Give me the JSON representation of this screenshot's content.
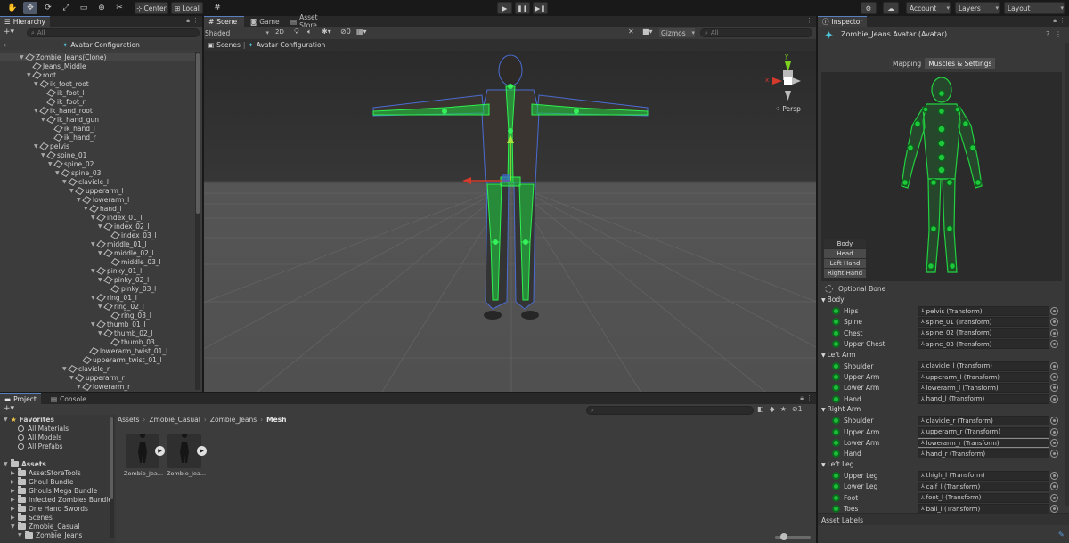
{
  "toolbar": {
    "center_label": "Center",
    "local_label": "Local",
    "account_label": "Account",
    "layers_label": "Layers",
    "layout_label": "Layout"
  },
  "hierarchy": {
    "tab": "Hierarchy",
    "search_placeholder": "All",
    "header": "Avatar Configuration",
    "items": [
      {
        "label": "Zombie_Jeans(Clone)"
      },
      {
        "label": "Jeans_Middle"
      },
      {
        "label": "root"
      },
      {
        "label": "ik_foot_root"
      },
      {
        "label": "ik_foot_l"
      },
      {
        "label": "ik_foot_r"
      },
      {
        "label": "ik_hand_root"
      },
      {
        "label": "ik_hand_gun"
      },
      {
        "label": "ik_hand_l"
      },
      {
        "label": "ik_hand_r"
      },
      {
        "label": "pelvis"
      },
      {
        "label": "spine_01"
      },
      {
        "label": "spine_02"
      },
      {
        "label": "spine_03"
      },
      {
        "label": "clavicle_l"
      },
      {
        "label": "upperarm_l"
      },
      {
        "label": "lowerarm_l"
      },
      {
        "label": "hand_l"
      },
      {
        "label": "index_01_l"
      },
      {
        "label": "index_02_l"
      },
      {
        "label": "index_03_l"
      },
      {
        "label": "middle_01_l"
      },
      {
        "label": "middle_02_l"
      },
      {
        "label": "middle_03_l"
      },
      {
        "label": "pinky_01_l"
      },
      {
        "label": "pinky_02_l"
      },
      {
        "label": "pinky_03_l"
      },
      {
        "label": "ring_01_l"
      },
      {
        "label": "ring_02_l"
      },
      {
        "label": "ring_03_l"
      },
      {
        "label": "thumb_01_l"
      },
      {
        "label": "thumb_02_l"
      },
      {
        "label": "thumb_03_l"
      },
      {
        "label": "lowerarm_twist_01_l"
      },
      {
        "label": "upperarm_twist_01_l"
      },
      {
        "label": "clavicle_r"
      },
      {
        "label": "upperarm_r"
      },
      {
        "label": "lowerarm_r"
      }
    ]
  },
  "scene": {
    "tabs": [
      "Scene",
      "Game",
      "Asset Store"
    ],
    "shading": "Shaded",
    "mode_2d": "2D",
    "fx_count": "0",
    "gizmos": "Gizmos",
    "search_placeholder": "All",
    "breadcrumb_root": "Scenes",
    "breadcrumb_current": "Avatar Configuration",
    "persp_label": "Persp",
    "gizmo_y": "y",
    "gizmo_x": "x"
  },
  "inspector": {
    "tab": "Inspector",
    "title": "Zombie_Jeans Avatar (Avatar)",
    "subtabs": [
      "Mapping",
      "Muscles & Settings"
    ],
    "view_buttons": [
      "Body",
      "Head",
      "Left Hand",
      "Right Hand"
    ],
    "optional_bone": "Optional Bone",
    "sections": [
      {
        "title": "Body",
        "rows": [
          {
            "label": "Hips",
            "value": "pelvis (Transform)"
          },
          {
            "label": "Spine",
            "value": "spine_01 (Transform)"
          },
          {
            "label": "Chest",
            "value": "spine_02 (Transform)"
          },
          {
            "label": "Upper Chest",
            "value": "spine_03 (Transform)"
          }
        ]
      },
      {
        "title": "Left Arm",
        "rows": [
          {
            "label": "Shoulder",
            "value": "clavicle_l (Transform)"
          },
          {
            "label": "Upper Arm",
            "value": "upperarm_l (Transform)"
          },
          {
            "label": "Lower Arm",
            "value": "lowerarm_l (Transform)"
          },
          {
            "label": "Hand",
            "value": "hand_l (Transform)"
          }
        ]
      },
      {
        "title": "Right Arm",
        "rows": [
          {
            "label": "Shoulder",
            "value": "clavicle_r (Transform)"
          },
          {
            "label": "Upper Arm",
            "value": "upperarm_r (Transform)"
          },
          {
            "label": "Lower Arm",
            "value": "lowerarm_r (Transform)"
          },
          {
            "label": "Hand",
            "value": "hand_r (Transform)"
          }
        ]
      },
      {
        "title": "Left Leg",
        "rows": [
          {
            "label": "Upper Leg",
            "value": "thigh_l (Transform)"
          },
          {
            "label": "Lower Leg",
            "value": "calf_l (Transform)"
          },
          {
            "label": "Foot",
            "value": "foot_l (Transform)"
          },
          {
            "label": "Toes",
            "value": "ball_l (Transform)"
          }
        ]
      }
    ],
    "asset_labels": "Asset Labels"
  },
  "project": {
    "tabs": [
      "Project",
      "Console"
    ],
    "favorites": {
      "title": "Favorites",
      "items": [
        "All Materials",
        "All Models",
        "All Prefabs"
      ]
    },
    "assets": {
      "title": "Assets",
      "items": [
        "AssetStoreTools",
        "Ghoul Bundle",
        "Ghouls Mega Bundle",
        "Infected Zombies Bundle",
        "One Hand Swords",
        "Scenes",
        "Zmobie_Casual",
        "Zombie_Jeans"
      ]
    },
    "breadcrumb": [
      "Assets",
      "Zmobie_Casual",
      "Zombie_Jeans",
      "Mesh"
    ],
    "files": [
      "Zombie_Jea...",
      "Zombie_Jea..."
    ],
    "hidden_count": "1"
  },
  "colors": {
    "accent_green": "#1dbd3a",
    "selection_blue": "#2c5d87",
    "axis_red": "#d33a2c",
    "axis_green": "#7ed321"
  }
}
